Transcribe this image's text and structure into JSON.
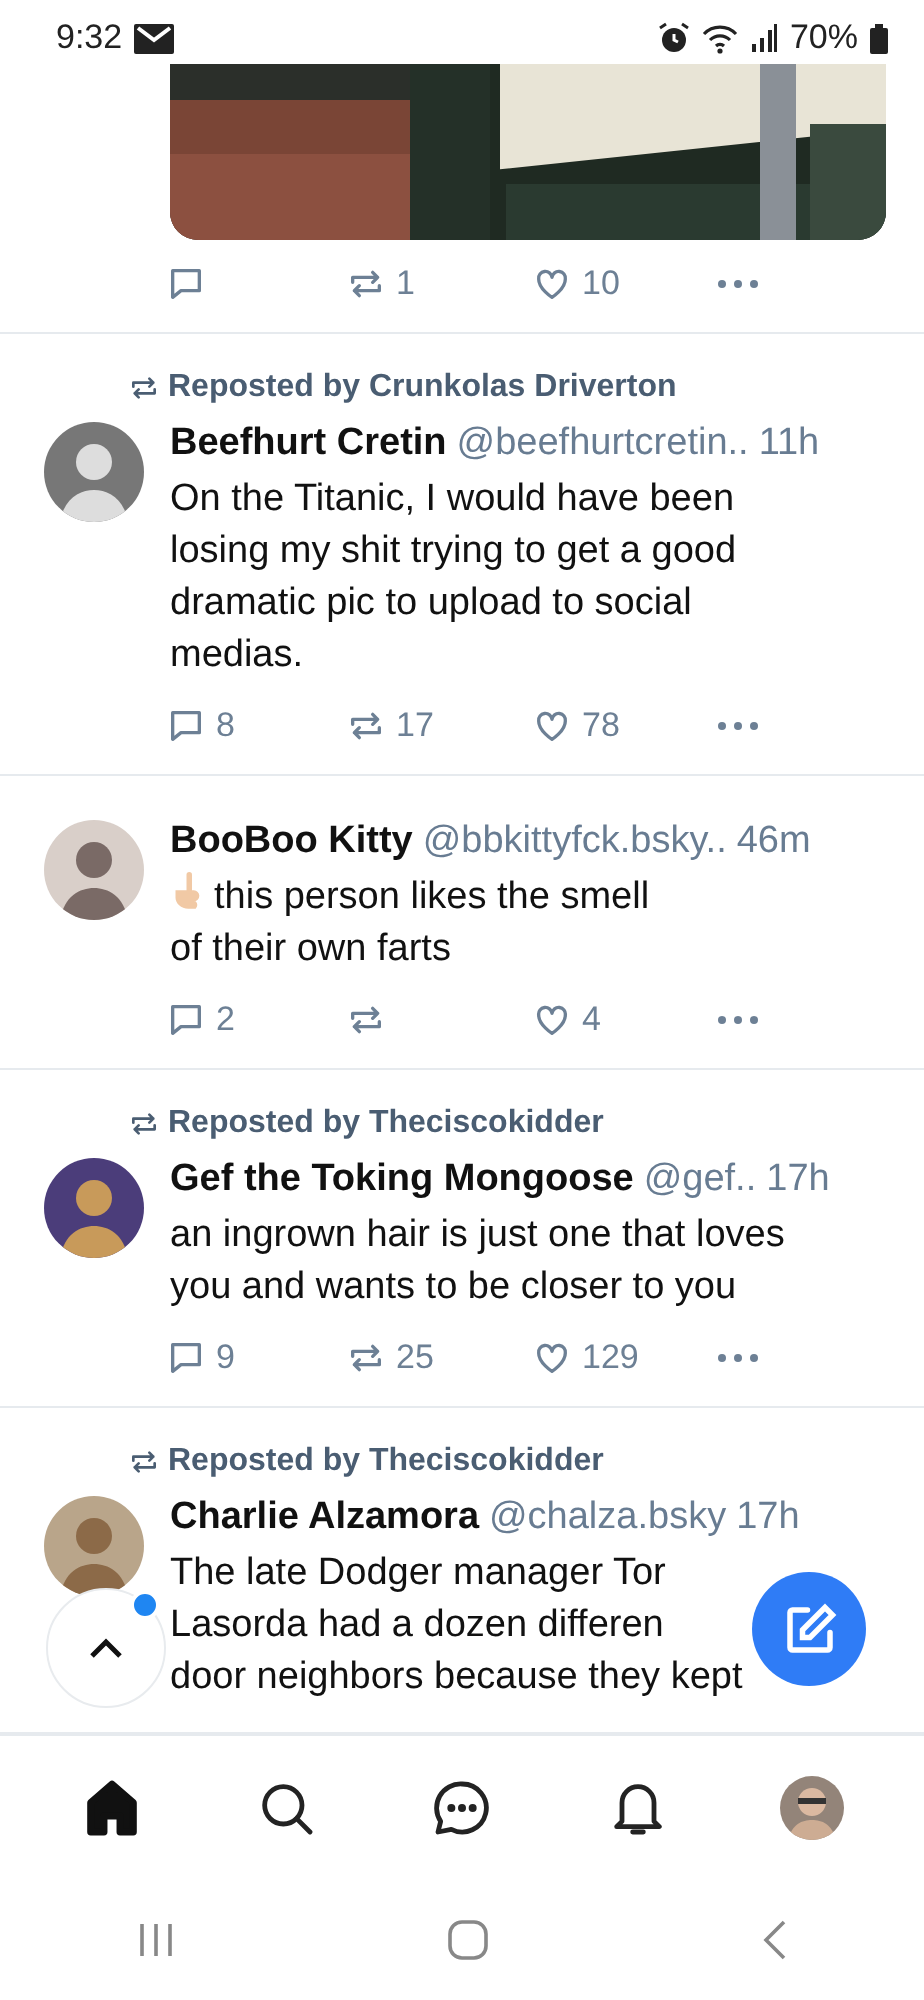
{
  "status_bar": {
    "time": "9:32",
    "battery": "70%"
  },
  "posts": [
    {
      "kind": "media",
      "actions": {
        "repost": "1",
        "like": "10"
      }
    },
    {
      "kind": "text",
      "reposted_by": "Reposted by Crunkolas Driverton",
      "name": "Beefhurt Cretin",
      "handle": "@beefhurtcretin..",
      "time": "11h",
      "body": "On the Titanic, I would have been\nlosing my shit trying to get a good\ndramatic pic to upload to social\nmedias.",
      "actions": {
        "reply": "8",
        "repost": "17",
        "like": "78"
      }
    },
    {
      "kind": "emoji_text",
      "name": "BooBoo Kitty",
      "handle": "@bbkittyfck.bsky..",
      "time": "46m",
      "body": "this person likes the smell\nof their own farts",
      "actions": {
        "reply": "2",
        "like": "4"
      }
    },
    {
      "kind": "text",
      "reposted_by": "Reposted by Theciscokidder",
      "name": "Gef the Toking Mongoose",
      "handle": "@gef..",
      "time": "17h",
      "body": "an ingrown hair is just one that loves\nyou and wants to be closer to you",
      "actions": {
        "reply": "9",
        "repost": "25",
        "like": "129"
      }
    },
    {
      "kind": "text",
      "reposted_by": "Reposted by Theciscokidder",
      "name": "Charlie Alzamora",
      "handle": "@chalza.bsky",
      "time": "17h",
      "body": "The late Dodger manager Tor\nLasorda had a dozen differen\ndoor neighbors because they kept"
    }
  ],
  "scroll_top": {
    "unread": true
  },
  "bottom_nav": [
    {
      "kind": "home",
      "selected": true
    },
    {
      "kind": "search",
      "selected": false
    },
    {
      "kind": "chat",
      "selected": false
    },
    {
      "kind": "bell",
      "selected": false
    },
    {
      "kind": "avatar",
      "selected": false
    }
  ]
}
